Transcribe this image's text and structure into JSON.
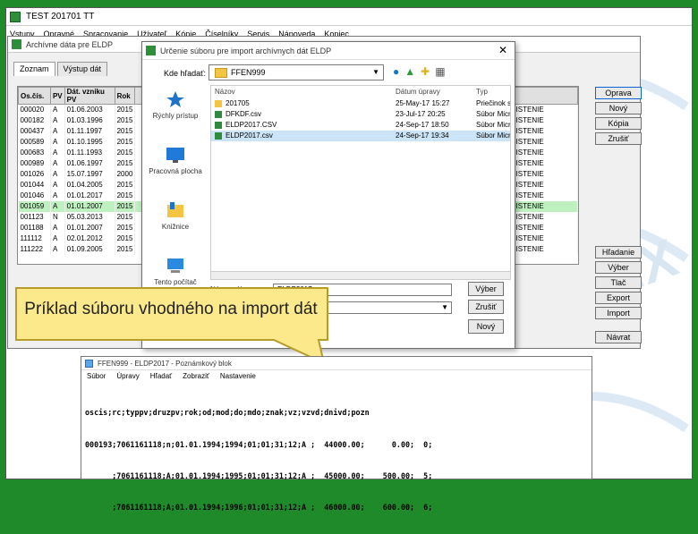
{
  "main_window": {
    "title": "TEST 201701 TT",
    "menu": [
      "Vstupy",
      "Opravné",
      "Spracovanie",
      "Užívateľ",
      "Kópie",
      "Číselníky",
      "Servis",
      "Nápoveda",
      "Koniec"
    ]
  },
  "archive_dialog": {
    "title": "Archívne dáta pre ELDP",
    "tabs": [
      "Zoznam",
      "Výstup dát"
    ],
    "columns": [
      "Os.čís.",
      "PV",
      "Dát. vzniku PV",
      "Rok",
      "",
      "",
      ""
    ],
    "rows": [
      [
        "000020",
        "A",
        "01.06.2003",
        "2015",
        "VE POISTENIE"
      ],
      [
        "000182",
        "A",
        "01.03.1996",
        "2015",
        "VE POISTENIE"
      ],
      [
        "000437",
        "A",
        "01.11.1997",
        "2015",
        "VE POISTENIE"
      ],
      [
        "000589",
        "A",
        "01.10.1995",
        "2015",
        "VE POISTENIE"
      ],
      [
        "000683",
        "A",
        "01.11.1993",
        "2015",
        "VE POISTENIE"
      ],
      [
        "000989",
        "A",
        "01.06.1997",
        "2015",
        "VE POISTENIE"
      ],
      [
        "001026",
        "A",
        "15.07.1997",
        "2000",
        "VE POISTENIE"
      ],
      [
        "001044",
        "A",
        "01.04.2005",
        "2015",
        "VE POISTENIE"
      ],
      [
        "001046",
        "A",
        "01.01.2017",
        "2015",
        "VE POISTENIE"
      ],
      [
        "001059",
        "A",
        "01.01.2007",
        "2015",
        "VE POISTENIE"
      ],
      [
        "001123",
        "N",
        "05.03.2013",
        "2015",
        "VE POISTENIE"
      ],
      [
        "001188",
        "A",
        "01.01.2007",
        "2015",
        "VE POISTENIE"
      ],
      [
        "111112",
        "A",
        "02.01.2012",
        "2015",
        "VE POISTENIE"
      ],
      [
        "111222",
        "A",
        "01.09.2005",
        "2015",
        "VE POISTENIE"
      ]
    ],
    "selected_row": 9,
    "side_buttons_top": [
      "Oprava",
      "Nový",
      "Kópia",
      "Zrušiť"
    ],
    "side_buttons_bottom": [
      "Hľadanie",
      "Výber",
      "Tlač",
      "Export",
      "Import"
    ],
    "close_button": "Návrat"
  },
  "file_dialog": {
    "title": "Určenie súboru pre import archívnych dát ELDP",
    "lookin_label": "Kde hľadať:",
    "lookin_value": "FFEN999",
    "places": [
      "Rýchly prístup",
      "Pracovná plocha",
      "Knižnice",
      "Tento počítač"
    ],
    "columns": [
      "Názov",
      "Dátum úpravy",
      "Typ"
    ],
    "files": [
      {
        "name": "201705",
        "date": "25-May-17 15:27",
        "type": "Priečinok s"
      },
      {
        "name": "DFKDF.csv",
        "date": "23-Jul-17 20:25",
        "type": "Súbor Micr"
      },
      {
        "name": "ELDP2017.CSV",
        "date": "24-Sep-17 18:50",
        "type": "Súbor Micr"
      },
      {
        "name": "ELDP2017.csv",
        "date": "24-Sep-17 19:34",
        "type": "Súbor Micr"
      }
    ],
    "selected_file": 3,
    "filename_label": "Názov súboru:",
    "filename_value": "ELDP2017.",
    "buttons": [
      "Výber",
      "Zrušiť",
      "Nový"
    ]
  },
  "callout": {
    "text": "Príklad súboru vhodného na import dát"
  },
  "notepad": {
    "title": "FFEN999 - ELDP2017 - Poznámkový blok",
    "menu": [
      "Súbor",
      "Úpravy",
      "Hľadať",
      "Zobraziť",
      "Nastavenie"
    ],
    "lines": [
      "oscis;rc;typpv;druzpv;rok;od;mod;do;mdo;znak;vz;vzvd;dnivd;pozn",
      "000193;7061161118;n;01.01.1994;1994;01;01;31;12;A ;  44000.00;      0.00;  0;",
      "      ;7061161118;A;01.01.1994;1995;01;01;31;12;A ;  45000.00;    500.00;  5;",
      "      ;7061161118;A;01.01.1994;1996;01;01;31;12;A ;  46000.00;    600.00;  6;"
    ]
  },
  "colors": {
    "background_green": "#1f8a2a",
    "callout_fill": "#fbe98b",
    "callout_border": "#b89c2a",
    "selected_row": "#bff0c0",
    "selected_file": "#cce4f7"
  }
}
